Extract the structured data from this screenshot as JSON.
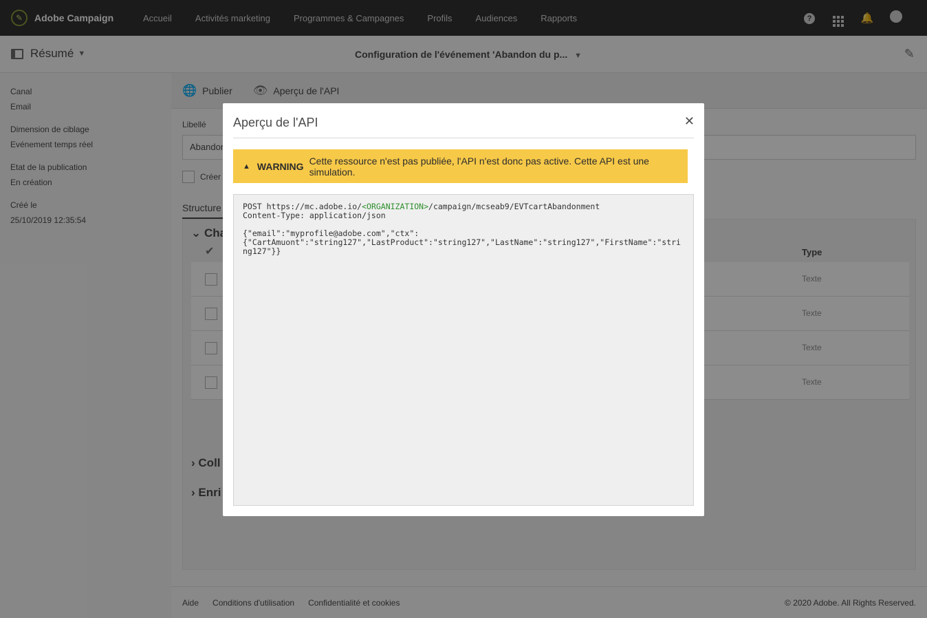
{
  "app": {
    "brand": "Adobe Campaign"
  },
  "nav": {
    "items": [
      "Accueil",
      "Activités marketing",
      "Programmes & Campagnes",
      "Profils",
      "Audiences",
      "Rapports"
    ]
  },
  "subheader": {
    "resume_label": "Résumé",
    "title": "Configuration de l'événement 'Abandon du p..."
  },
  "sidebar": {
    "meta": [
      {
        "label": "Canal",
        "value": "Email"
      },
      {
        "label": "Dimension de ciblage",
        "value": "Evénement temps réel"
      },
      {
        "label": "Etat de la publication",
        "value": "En création"
      },
      {
        "label": "Créé le",
        "value": "25/10/2019 12:35:54"
      }
    ]
  },
  "toolbar": {
    "publish_label": "Publier",
    "api_preview_label": "Aperçu de l'API"
  },
  "form": {
    "libelle_label": "Libellé",
    "libelle_value": "Abandon",
    "checkbox_label": "Créer",
    "tab_structure": "Structure",
    "section_fields": "Cha",
    "type_header": "Type",
    "rows": [
      {
        "type": "Texte"
      },
      {
        "type": "Texte"
      },
      {
        "type": "Texte"
      },
      {
        "type": "Texte"
      }
    ],
    "section_collection": "Coll",
    "section_enrich": "Enri"
  },
  "footer": {
    "links": [
      "Aide",
      "Conditions d'utilisation",
      "Confidentialité et cookies"
    ],
    "copyright": "© 2020 Adobe. All Rights Reserved."
  },
  "modal": {
    "title": "Aperçu de l'API",
    "warning_label": "WARNING",
    "warning_text": "Cette ressource n'est pas publiée, l'API n'est donc pas active. Cette API est une simulation.",
    "code": {
      "method_prefix": "POST https://mc.adobe.io/",
      "org_token": "<ORGANIZATION>",
      "path_suffix": "/campaign/mcseab9/EVTcartAbandonment",
      "content_type": "Content-Type: application/json",
      "body": "{\"email\":\"myprofile@adobe.com\",\"ctx\":\n{\"CartAmuont\":\"string127\",\"LastProduct\":\"string127\",\"LastName\":\"string127\",\"FirstName\":\"string127\"}}"
    }
  }
}
